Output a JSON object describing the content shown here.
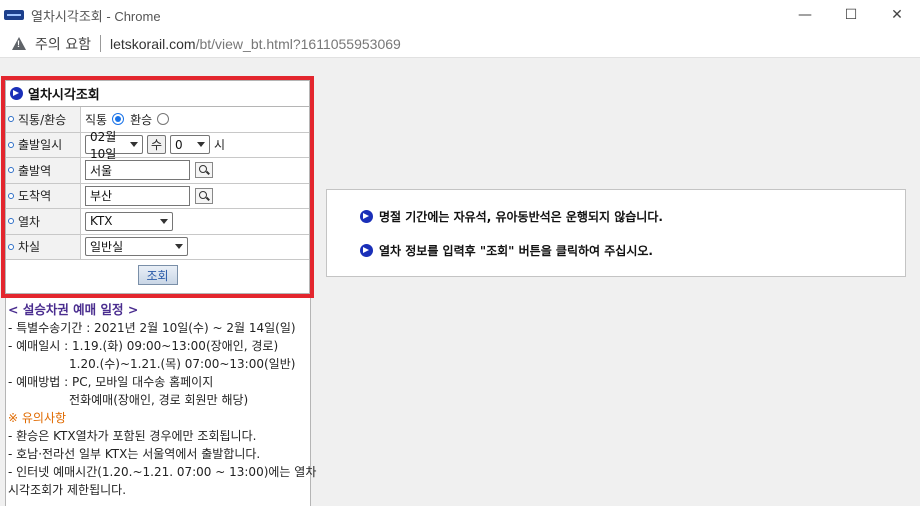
{
  "window": {
    "title": "열차시각조회 - Chrome",
    "minimize": "—",
    "maximize": "☐",
    "close": "✕"
  },
  "address": {
    "warning": "주의 요함",
    "url_host": "letskorail.com",
    "url_path": "/bt/view_bt.html?1611055953069"
  },
  "search": {
    "title": "열차시각조회",
    "rows": {
      "direct": {
        "label": "직통/환승",
        "option1": "직통",
        "option2": "환승"
      },
      "date": {
        "label": "출발일시",
        "month_day": "02월 10일",
        "weekday": "수",
        "hour": "0",
        "hour_unit": "시"
      },
      "departure": {
        "label": "출발역",
        "value": "서울"
      },
      "arrival": {
        "label": "도착역",
        "value": "부산"
      },
      "train": {
        "label": "열차",
        "value": "KTX"
      },
      "seat": {
        "label": "차실",
        "value": "일반실"
      }
    },
    "button": "조회"
  },
  "info": {
    "title": "< 설승차권 예매 일정 >",
    "lines": [
      "- 특별수송기간 : 2021년 2월 10일(수) ~ 2월 14일(일)",
      "- 예매일시 : 1.19.(화) 09:00~13:00(장애인, 경로)",
      "                1.20.(수)~1.21.(목) 07:00~13:00(일반)",
      "- 예매방법 : PC, 모바일 대수송 홈페이지",
      "                전화예매(장애인, 경로 회원만 해당)"
    ],
    "warn_title": "※ 유의사항",
    "notes": [
      "- 환승은 KTX열차가 포함된 경우에만 조회됩니다.",
      "- 호남·전라선 일부 KTX는 서울역에서 출발합니다.",
      "- 인터넷 예매시간(1.20.~1.21. 07:00 ~ 13:00)에는 열차",
      "시각조회가 제한됩니다."
    ]
  },
  "notice": {
    "line1": "명절 기간에는 자유석, 유아동반석은 운행되지 않습니다.",
    "line2": "열차 정보를 입력후 \"조회\" 버튼을 클릭하여 주십시오."
  }
}
